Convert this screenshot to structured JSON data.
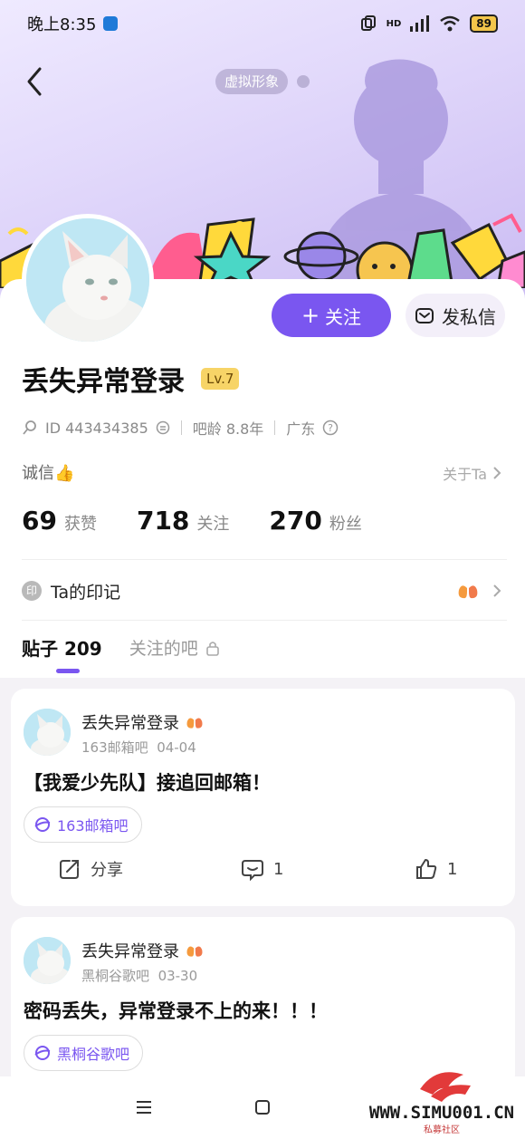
{
  "status_bar": {
    "time": "晚上8:35",
    "network": "HD",
    "battery": "89"
  },
  "header": {
    "virtual_tag": "虚拟形象"
  },
  "profile": {
    "name": "丢失异常登录",
    "level": "Lv.7",
    "id_text": "ID 443434385",
    "bar_age": "吧龄 8.8年",
    "location": "广东",
    "credit": "诚信👍",
    "about": "关于Ta",
    "follow_label": "关注",
    "message_label": "发私信"
  },
  "stats": [
    {
      "num": "69",
      "label": "获赞"
    },
    {
      "num": "718",
      "label": "关注"
    },
    {
      "num": "270",
      "label": "粉丝"
    }
  ],
  "mark": {
    "badge": "印",
    "label": "Ta的印记"
  },
  "tabs": {
    "posts": "贴子 209",
    "followed_bars": "关注的吧"
  },
  "posts": [
    {
      "author": "丢失异常登录",
      "forum": "163邮箱吧",
      "date": "04-04",
      "title": "【我爱少先队】接追回邮箱！",
      "tag": "163邮箱吧",
      "share": "分享",
      "comments": "1",
      "likes": "1"
    },
    {
      "author": "丢失异常登录",
      "forum": "黑桐谷歌吧",
      "date": "03-30",
      "title": "密码丢失，异常登录不上的来！！！",
      "tag": "黑桐谷歌吧"
    }
  ],
  "watermark": {
    "site": "WWW.SIMU001.CN",
    "sub": "私募社区"
  },
  "colors": {
    "accent": "#7a56f0",
    "level_badge": "#f7d467",
    "banner": "#ddd3fa"
  },
  "icons": [
    "back-icon",
    "search-icon",
    "copy-icon",
    "help-icon",
    "chevron-right-icon",
    "mail-icon",
    "lock-icon",
    "share-icon",
    "comment-icon",
    "like-icon",
    "menu-icon",
    "home-icon",
    "back-nav-icon"
  ]
}
